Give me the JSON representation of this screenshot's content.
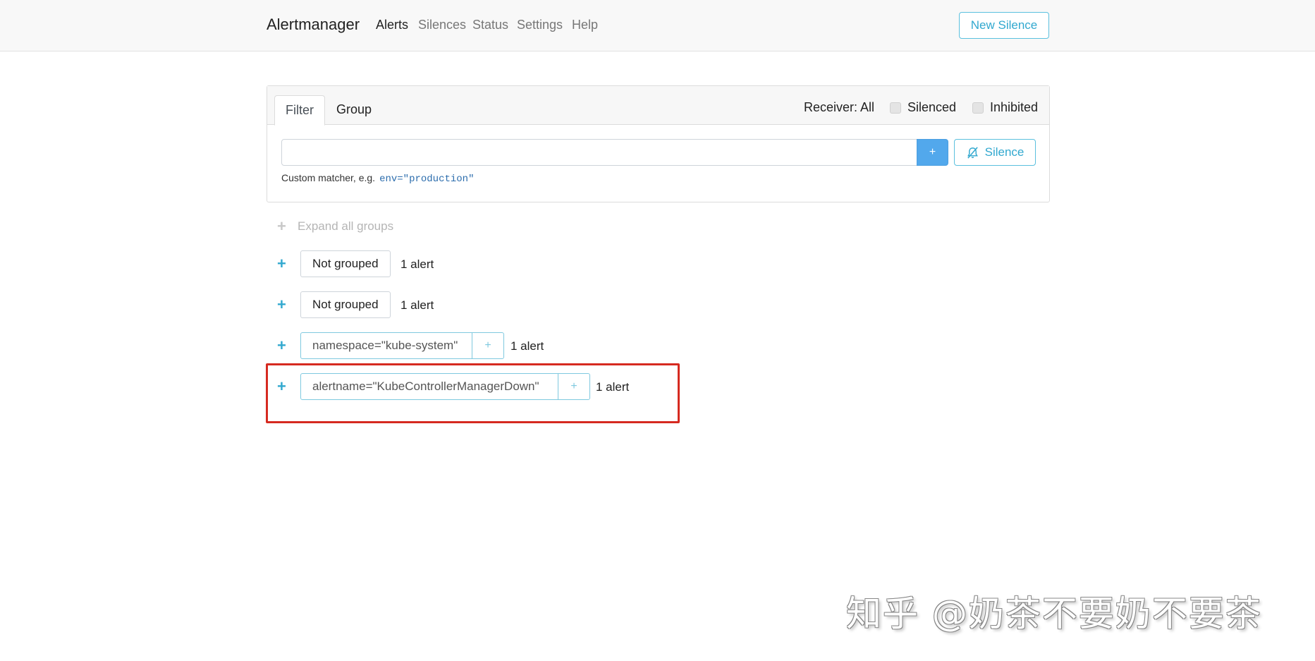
{
  "navbar": {
    "brand": "Alertmanager",
    "links": [
      "Alerts",
      "Silences",
      "Status",
      "Settings",
      "Help"
    ],
    "active": "Alerts",
    "new_silence_label": "New Silence"
  },
  "filter_card": {
    "tabs": [
      "Filter",
      "Group"
    ],
    "active_tab": "Filter",
    "receiver_label": "Receiver: All",
    "silenced_label": "Silenced",
    "inhibited_label": "Inhibited",
    "input_value": "",
    "add_label": "+",
    "silence_label": "Silence",
    "hint_text": "Custom matcher, e.g.",
    "hint_example": "env=\"production\""
  },
  "groups": {
    "expand_all_label": "Expand all groups",
    "items": [
      {
        "label": "Not grouped",
        "count": "1 alert"
      },
      {
        "label": "Not grouped",
        "count": "1 alert"
      },
      {
        "label": "namespace=\"kube-system\"",
        "add": "+",
        "count": "1 alert"
      },
      {
        "label": "alertname=\"KubeControllerManagerDown\"",
        "add": "+",
        "count": "1 alert"
      }
    ]
  },
  "watermark": "知乎 @奶茶不要奶不要茶",
  "colors": {
    "accent": "#31a8cf",
    "primary_button": "#52a8ec",
    "highlight_box": "#d62a20"
  }
}
